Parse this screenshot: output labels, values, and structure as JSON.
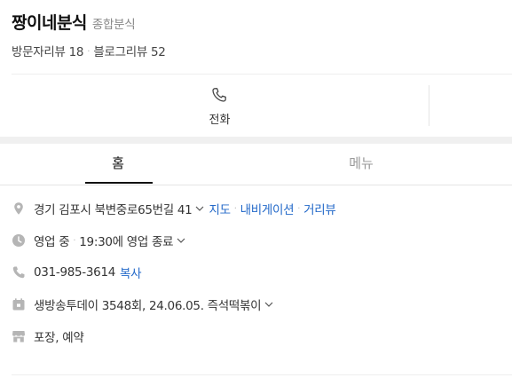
{
  "place": {
    "name": "짱이네분식",
    "category": "종합분식",
    "visitor_review": "방문자리뷰 18",
    "blog_review": "블로그리뷰 52"
  },
  "actions": {
    "call_label": "전화"
  },
  "tabs": [
    {
      "label": "홈",
      "active": true
    },
    {
      "label": "메뉴",
      "active": false
    }
  ],
  "info": {
    "address": "경기 김포시 북변중로65번길 41",
    "address_links": [
      "지도",
      "내비게이션",
      "거리뷰"
    ],
    "hours_status": "영업 중",
    "hours_detail": "19:30에 영업 종료",
    "phone": "031-985-3614",
    "phone_copy": "복사",
    "tv_info": "생방송투데이 3548회, 24.06.05. 즉석떡볶이",
    "services": "포장, 예약"
  },
  "colors": {
    "link": "#2369c9",
    "icon": "#b5b5b5"
  }
}
